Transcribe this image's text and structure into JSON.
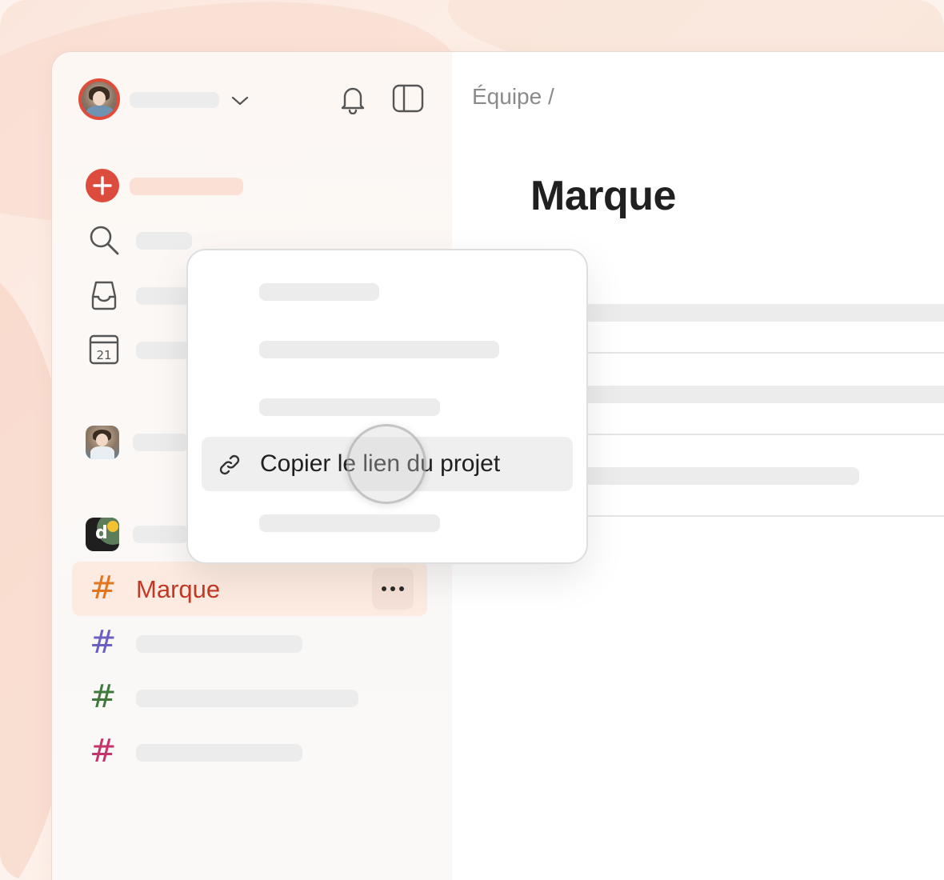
{
  "main": {
    "breadcrumb": "Équipe /",
    "title": "Marque"
  },
  "sidebar": {
    "active_project": {
      "label": "Marque",
      "hash": "#",
      "color": "#e2751f"
    },
    "projects": [
      {
        "hash": "#",
        "color": "#6b5fc2"
      },
      {
        "hash": "#",
        "color": "#3f7a3b"
      },
      {
        "hash": "#",
        "color": "#c4356b"
      }
    ],
    "calendar_day": "21",
    "team_logo_letter": "d",
    "more_icon": "ellipsis-icon"
  },
  "context_menu": {
    "active_item": {
      "label": "Copier le lien du projet",
      "icon": "link-icon"
    }
  },
  "colors": {
    "accent": "#dc4c3e",
    "active_bg": "#fdebe1"
  }
}
